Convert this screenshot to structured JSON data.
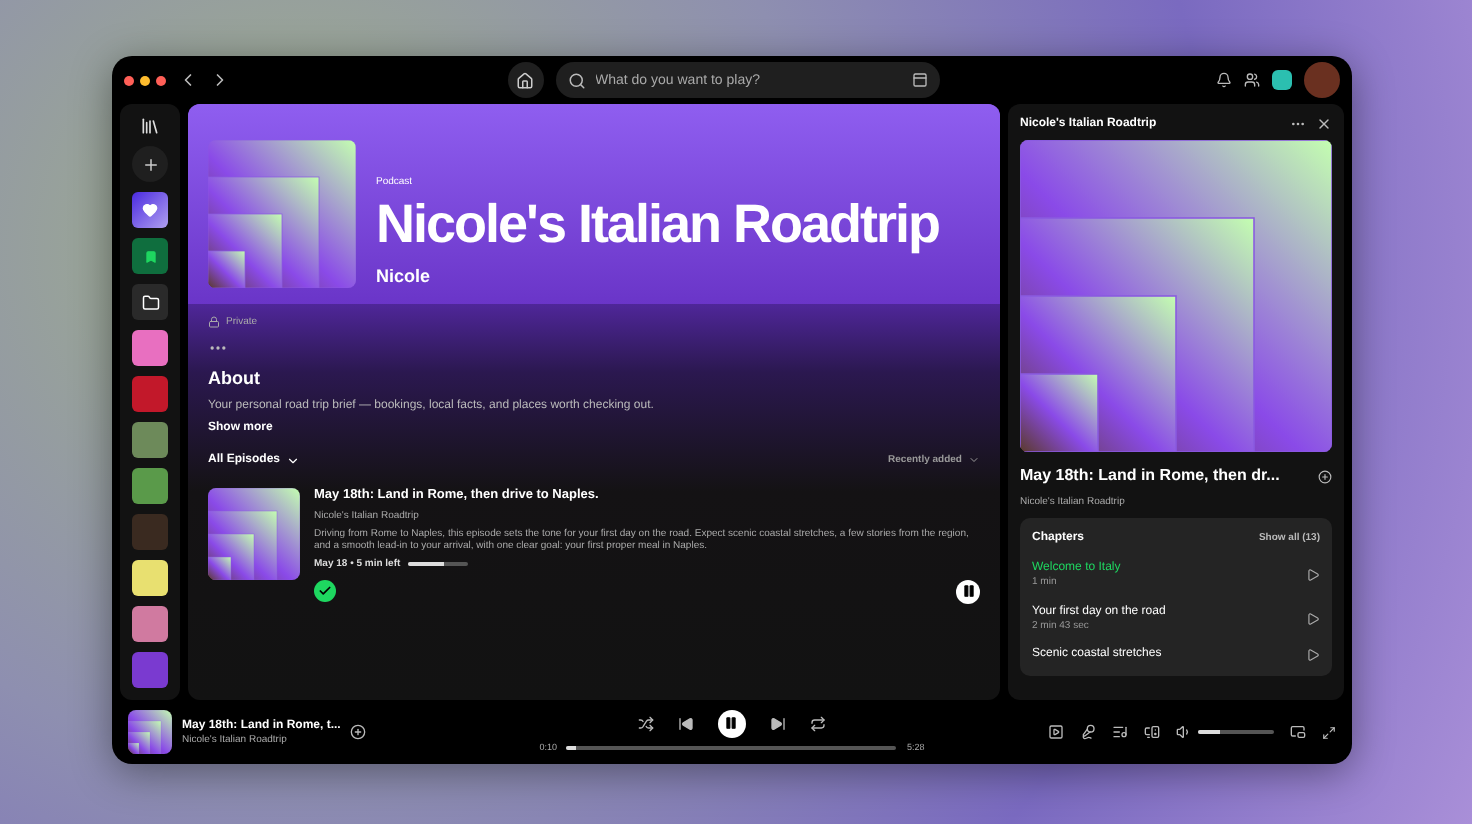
{
  "top_bar": {
    "search": {
      "placeholder": "What do you want to play?"
    }
  },
  "show": {
    "type_label": "Podcast",
    "title": "Nicole's Italian Roadtrip",
    "author": "Nicole",
    "visibility": "Private",
    "about_heading": "About",
    "about_text": "Your personal road trip brief — bookings, local facts, and places worth checking out.",
    "show_more": "Show more"
  },
  "episodes": {
    "filter": "All Episodes",
    "sort": "Recently added",
    "items": [
      {
        "title": "May 18th: Land in Rome, then drive to Naples.",
        "show": "Nicole's Italian Roadtrip",
        "description": "Driving from Rome to Naples, this episode sets the tone for your first day on the road. Expect scenic coastal stretches, a few stories from the region, and a smooth lead-in to your arrival, with one clear goal: your first proper meal in Naples.",
        "meta": "May 18 • 5 min left",
        "level": 0.6,
        "added": true,
        "playing": true
      }
    ]
  },
  "now_playing_panel": {
    "title": "Nicole's Italian Roadtrip",
    "episode_title": "May 18th: Land in Rome, then dr...",
    "show": "Nicole's Italian Roadtrip",
    "chapters": {
      "heading": "Chapters",
      "show_all": "Show all (13)",
      "items": [
        {
          "title": "Welcome to Italy",
          "duration": "1 min",
          "selected": true
        },
        {
          "title": "Your first day on the road",
          "duration": "2 min 43 sec",
          "selected": false
        },
        {
          "title": "Scenic coastal stretches",
          "selected": false
        }
      ]
    }
  },
  "player": {
    "title": "May 18th: Land in Rome, t...",
    "show": "Nicole's Italian Roadtrip",
    "elapsed": "0:10",
    "total": "5:28",
    "level": 0.03,
    "playing": true,
    "volume": {
      "level": 0.3
    }
  }
}
